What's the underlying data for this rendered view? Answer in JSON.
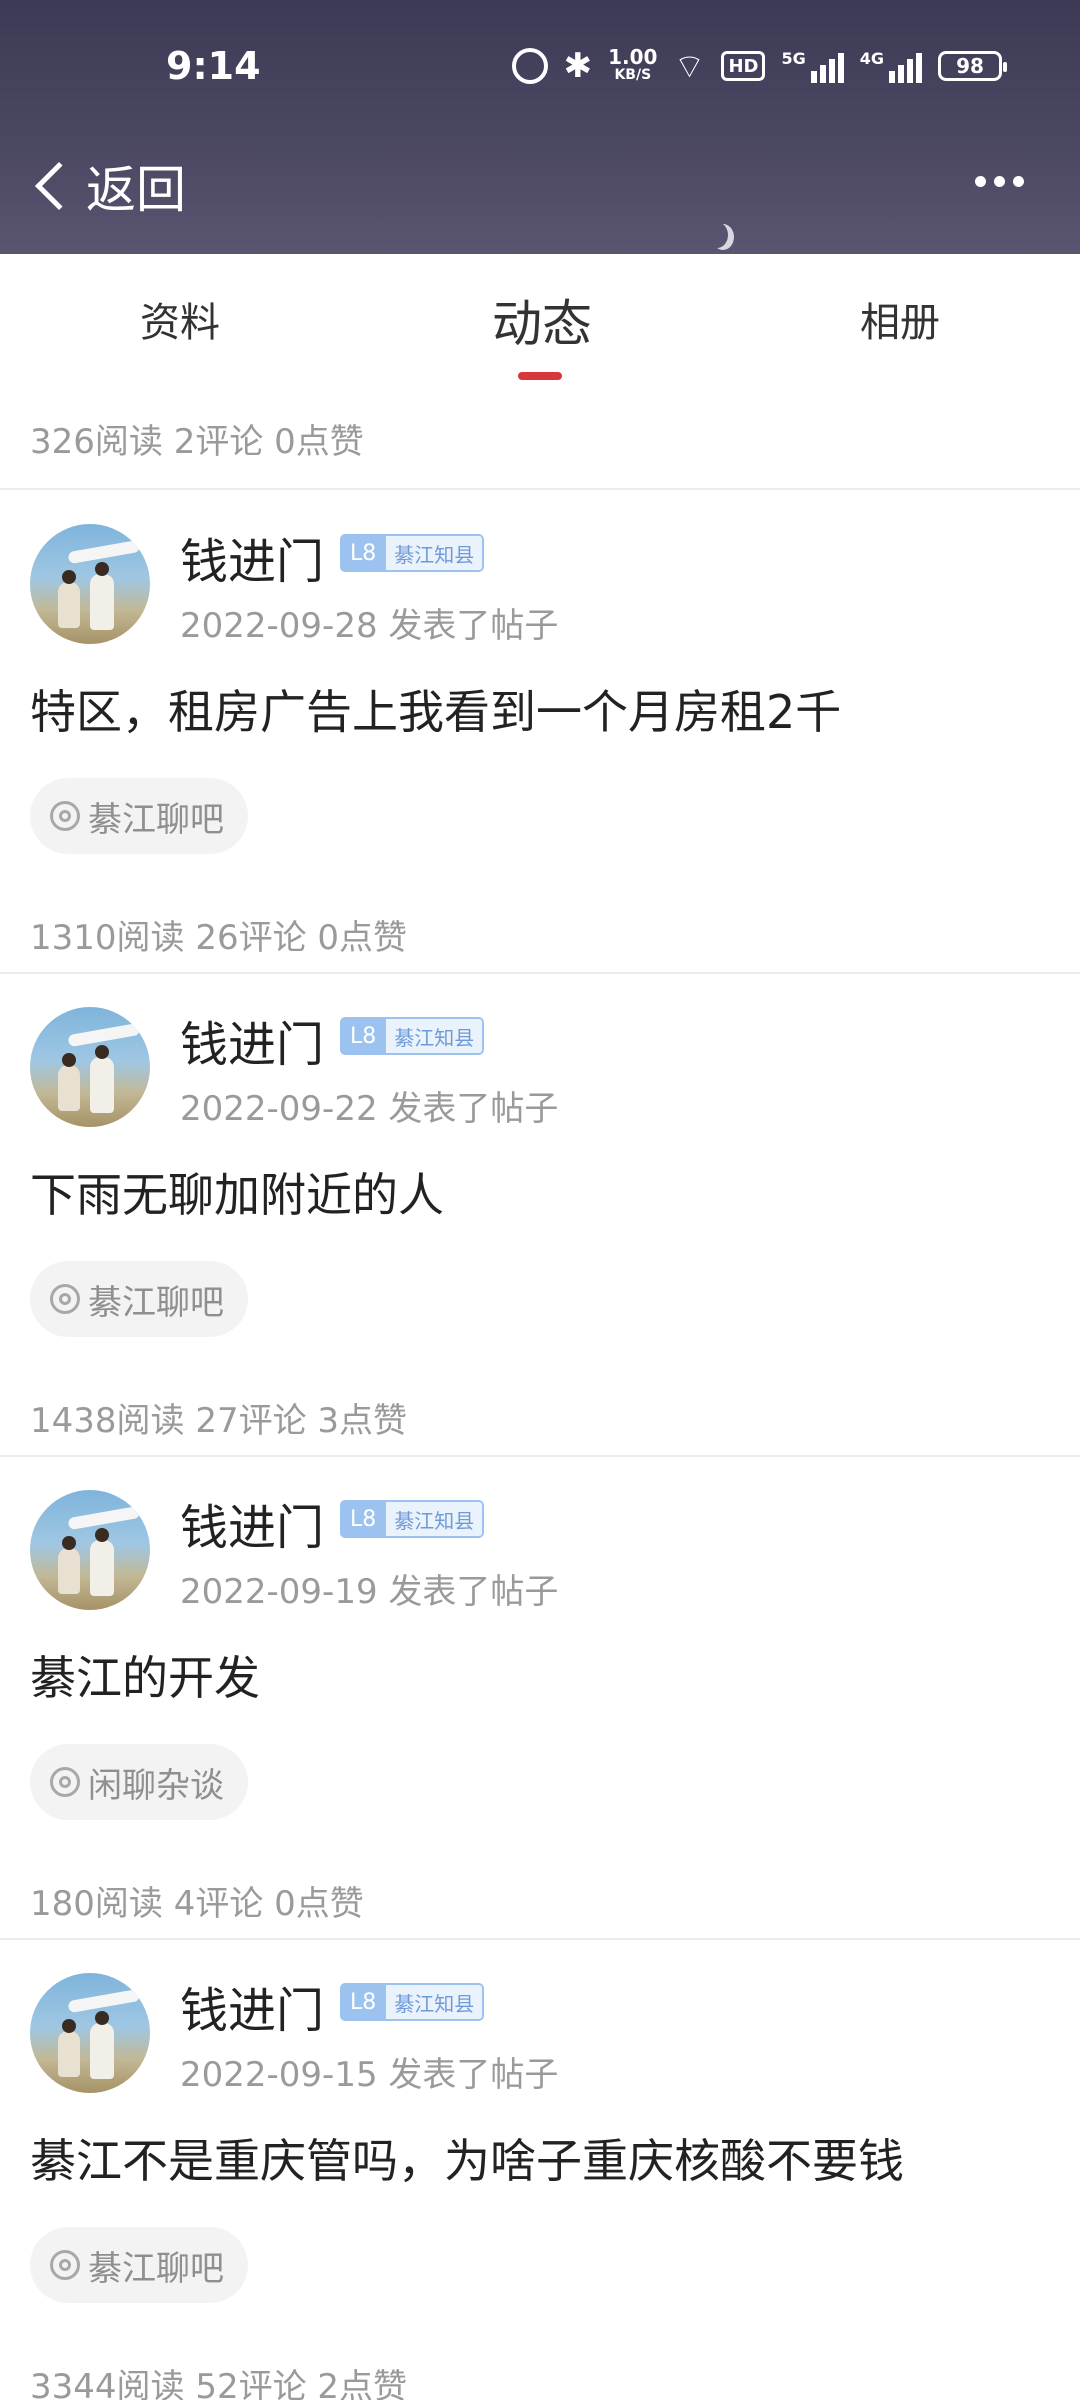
{
  "status_bar": {
    "time": "9:14",
    "net_speed": "1.00",
    "net_unit": "KB/S",
    "hd_label": "HD",
    "sim1_label": "5G",
    "sim2_label": "4G",
    "battery": "98"
  },
  "nav": {
    "back_label": "返回"
  },
  "tabs": [
    {
      "label": "资料"
    },
    {
      "label": "动态"
    },
    {
      "label": "相册"
    }
  ],
  "summary_top": "326阅读 2评论 0点赞",
  "posts": [
    {
      "username": "钱进门",
      "level": "L8",
      "badge_title": "綦江知县",
      "meta": "2022-09-28  发表了帖子",
      "content": "特区，租房广告上我看到一个月房租2千",
      "topic": "綦江聊吧",
      "stats": "1310阅读 26评论 0点赞"
    },
    {
      "username": "钱进门",
      "level": "L8",
      "badge_title": "綦江知县",
      "meta": "2022-09-22  发表了帖子",
      "content": "下雨无聊加附近的人",
      "topic": "綦江聊吧",
      "stats": "1438阅读 27评论 3点赞"
    },
    {
      "username": "钱进门",
      "level": "L8",
      "badge_title": "綦江知县",
      "meta": "2022-09-19  发表了帖子",
      "content": "綦江的开发",
      "topic": "闲聊杂谈",
      "stats": "180阅读 4评论 0点赞"
    },
    {
      "username": "钱进门",
      "level": "L8",
      "badge_title": "綦江知县",
      "meta": "2022-09-15  发表了帖子",
      "content": "綦江不是重庆管吗，为啥子重庆核酸不要钱",
      "topic": "綦江聊吧",
      "stats": "3344阅读 52评论 2点赞"
    }
  ],
  "colors": {
    "accent": "#d5373a",
    "badge_blue": "#9cc3f0",
    "muted_text": "#9a9a9a"
  }
}
